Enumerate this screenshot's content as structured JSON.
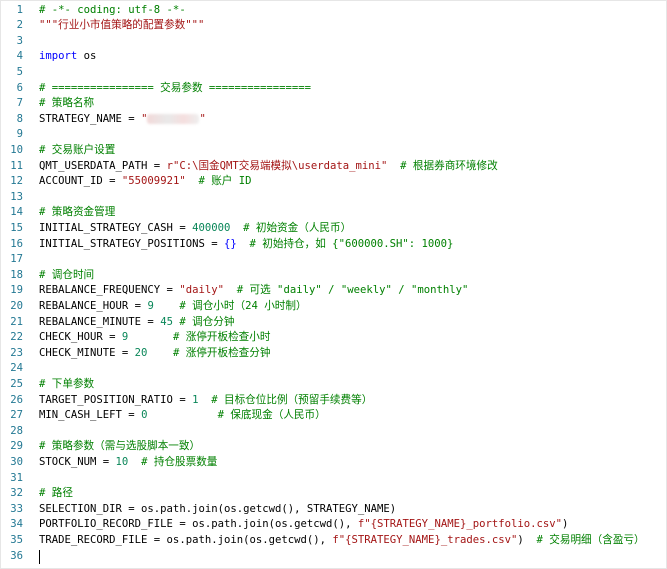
{
  "editor": {
    "language": "python",
    "line_number_color": "#237893",
    "colors": {
      "comment": "#008000",
      "string": "#a31515",
      "keyword": "#0000ff",
      "number": "#098658",
      "default": "#000000"
    },
    "lines": [
      {
        "n": "1",
        "tokens": [
          {
            "t": "# -*- coding: utf-8 -*-",
            "c": "cm"
          }
        ]
      },
      {
        "n": "2",
        "tokens": [
          {
            "t": "\"\"\"行业小市值策略的配置参数\"\"\"",
            "c": "st"
          }
        ]
      },
      {
        "n": "3",
        "tokens": []
      },
      {
        "n": "4",
        "tokens": [
          {
            "t": "import",
            "c": "kw"
          },
          {
            "t": " os",
            "c": ""
          }
        ]
      },
      {
        "n": "5",
        "tokens": []
      },
      {
        "n": "6",
        "tokens": [
          {
            "t": "# ================ 交易参数 ================",
            "c": "cm"
          }
        ]
      },
      {
        "n": "7",
        "tokens": [
          {
            "t": "# 策略名称",
            "c": "cm"
          }
        ]
      },
      {
        "n": "8",
        "tokens": [
          {
            "t": "STRATEGY_NAME = ",
            "c": ""
          },
          {
            "t": "\"",
            "c": "st"
          },
          {
            "t": "",
            "c": "blur"
          },
          {
            "t": "\"",
            "c": "st"
          }
        ]
      },
      {
        "n": "9",
        "tokens": []
      },
      {
        "n": "10",
        "tokens": [
          {
            "t": "# 交易账户设置",
            "c": "cm"
          }
        ]
      },
      {
        "n": "11",
        "tokens": [
          {
            "t": "QMT_USERDATA_PATH = ",
            "c": ""
          },
          {
            "t": "r\"C:\\国金QMT交易端模拟\\userdata_mini\"",
            "c": "st"
          },
          {
            "t": "  # 根据券商环境修改",
            "c": "cm"
          }
        ]
      },
      {
        "n": "12",
        "tokens": [
          {
            "t": "ACCOUNT_ID = ",
            "c": ""
          },
          {
            "t": "\"55009921\"",
            "c": "st"
          },
          {
            "t": "  # 账户 ID",
            "c": "cm"
          }
        ]
      },
      {
        "n": "13",
        "tokens": []
      },
      {
        "n": "14",
        "tokens": [
          {
            "t": "# 策略资金管理",
            "c": "cm"
          }
        ]
      },
      {
        "n": "15",
        "tokens": [
          {
            "t": "INITIAL_STRATEGY_CASH = ",
            "c": ""
          },
          {
            "t": "400000",
            "c": "nm"
          },
          {
            "t": "  # 初始资金（人民币）",
            "c": "cm"
          }
        ]
      },
      {
        "n": "16",
        "tokens": [
          {
            "t": "INITIAL_STRATEGY_POSITIONS = ",
            "c": ""
          },
          {
            "t": "{}",
            "c": "kw"
          },
          {
            "t": "  # 初始持仓，如 {\"600000.SH\": 1000}",
            "c": "cm"
          }
        ]
      },
      {
        "n": "17",
        "tokens": []
      },
      {
        "n": "18",
        "tokens": [
          {
            "t": "# 调仓时间",
            "c": "cm"
          }
        ]
      },
      {
        "n": "19",
        "tokens": [
          {
            "t": "REBALANCE_FREQUENCY = ",
            "c": ""
          },
          {
            "t": "\"daily\"",
            "c": "st"
          },
          {
            "t": "  # 可选 \"daily\" / \"weekly\" / \"monthly\"",
            "c": "cm"
          }
        ]
      },
      {
        "n": "20",
        "tokens": [
          {
            "t": "REBALANCE_HOUR = ",
            "c": ""
          },
          {
            "t": "9",
            "c": "nm"
          },
          {
            "t": "    # 调仓小时（24 小时制）",
            "c": "cm"
          }
        ]
      },
      {
        "n": "21",
        "tokens": [
          {
            "t": "REBALANCE_MINUTE = ",
            "c": ""
          },
          {
            "t": "45",
            "c": "nm"
          },
          {
            "t": " # 调仓分钟",
            "c": "cm"
          }
        ]
      },
      {
        "n": "22",
        "tokens": [
          {
            "t": "CHECK_HOUR = ",
            "c": ""
          },
          {
            "t": "9",
            "c": "nm"
          },
          {
            "t": "       # 涨停开板检查小时",
            "c": "cm"
          }
        ]
      },
      {
        "n": "23",
        "tokens": [
          {
            "t": "CHECK_MINUTE = ",
            "c": ""
          },
          {
            "t": "20",
            "c": "nm"
          },
          {
            "t": "    # 涨停开板检查分钟",
            "c": "cm"
          }
        ]
      },
      {
        "n": "24",
        "tokens": []
      },
      {
        "n": "25",
        "tokens": [
          {
            "t": "# 下单参数",
            "c": "cm"
          }
        ]
      },
      {
        "n": "26",
        "tokens": [
          {
            "t": "TARGET_POSITION_RATIO = ",
            "c": ""
          },
          {
            "t": "1",
            "c": "nm"
          },
          {
            "t": "  # 目标仓位比例（预留手续费等）",
            "c": "cm"
          }
        ]
      },
      {
        "n": "27",
        "tokens": [
          {
            "t": "MIN_CASH_LEFT = ",
            "c": ""
          },
          {
            "t": "0",
            "c": "nm"
          },
          {
            "t": "           # 保底现金（人民币）",
            "c": "cm"
          }
        ]
      },
      {
        "n": "28",
        "tokens": []
      },
      {
        "n": "29",
        "tokens": [
          {
            "t": "# 策略参数（需与选股脚本一致）",
            "c": "cm"
          }
        ]
      },
      {
        "n": "30",
        "tokens": [
          {
            "t": "STOCK_NUM = ",
            "c": ""
          },
          {
            "t": "10",
            "c": "nm"
          },
          {
            "t": "  # 持仓股票数量",
            "c": "cm"
          }
        ]
      },
      {
        "n": "31",
        "tokens": []
      },
      {
        "n": "32",
        "tokens": [
          {
            "t": "# 路径",
            "c": "cm"
          }
        ]
      },
      {
        "n": "33",
        "tokens": [
          {
            "t": "SELECTION_DIR = os.path.join(os.getcwd(), STRATEGY_NAME)",
            "c": ""
          }
        ]
      },
      {
        "n": "34",
        "tokens": [
          {
            "t": "PORTFOLIO_RECORD_FILE = os.path.join(os.getcwd(), ",
            "c": ""
          },
          {
            "t": "f\"{STRATEGY_NAME}_portfolio.csv\"",
            "c": "st"
          },
          {
            "t": ")",
            "c": ""
          }
        ]
      },
      {
        "n": "35",
        "tokens": [
          {
            "t": "TRADE_RECORD_FILE = os.path.join(os.getcwd(), ",
            "c": ""
          },
          {
            "t": "f\"{STRATEGY_NAME}_trades.csv\"",
            "c": "st"
          },
          {
            "t": ")  ",
            "c": ""
          },
          {
            "t": "# 交易明细（含盈亏）",
            "c": "cm"
          }
        ]
      },
      {
        "n": "36",
        "tokens": []
      }
    ]
  }
}
